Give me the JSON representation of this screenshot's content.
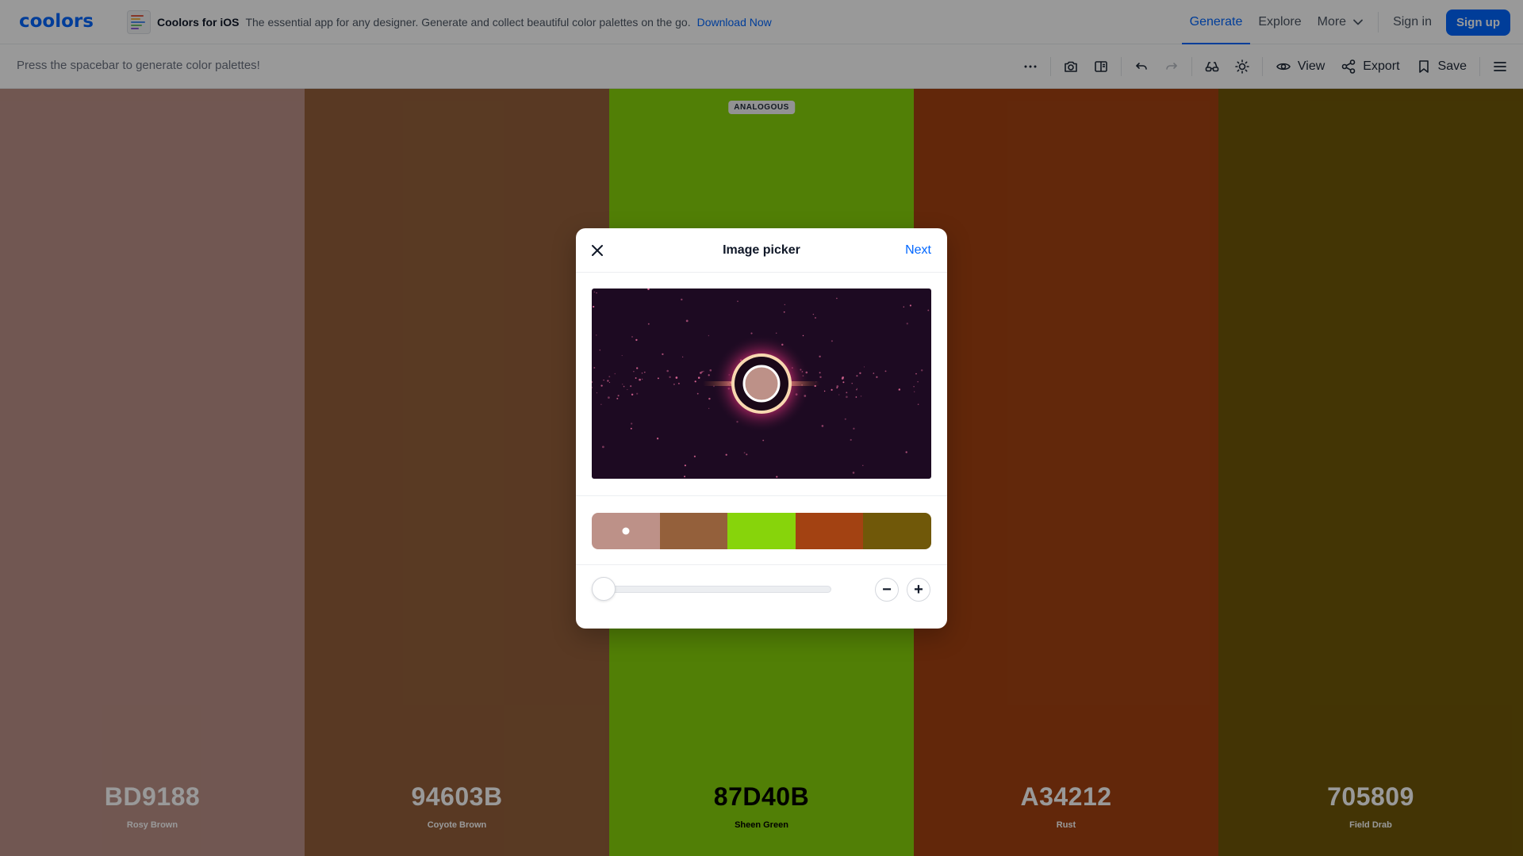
{
  "header": {
    "logo": "coolors",
    "promo": {
      "title": "Coolors for iOS",
      "text": "The essential app for any designer. Generate and collect beautiful color palettes on the go.",
      "link": "Download Now"
    },
    "nav": [
      {
        "label": "Generate",
        "active": true
      },
      {
        "label": "Explore",
        "active": false
      }
    ],
    "more": "More",
    "signin": "Sign in",
    "signup": "Sign up"
  },
  "toolbar": {
    "hint": "Press the spacebar to generate color palettes!",
    "icons": [
      "more-icon",
      "camera-icon",
      "columns-icon",
      "undo-icon",
      "redo-icon",
      "glasses-icon",
      "sun-icon"
    ],
    "view": "View",
    "export": "Export",
    "save": "Save"
  },
  "palette": {
    "badge": "ANALOGOUS",
    "colors": [
      {
        "hex": "BD9188",
        "name": "Rosy Brown",
        "bg": "#BD9188",
        "fg": "#ffffff"
      },
      {
        "hex": "94603B",
        "name": "Coyote Brown",
        "bg": "#94603B",
        "fg": "#ffffff"
      },
      {
        "hex": "87D40B",
        "name": "Sheen Green",
        "bg": "#87D40B",
        "fg": "#000000"
      },
      {
        "hex": "A34212",
        "name": "Rust",
        "bg": "#A34212",
        "fg": "#ffffff"
      },
      {
        "hex": "705809",
        "name": "Field Drab",
        "bg": "#705809",
        "fg": "#ffffff"
      }
    ]
  },
  "modal": {
    "title": "Image picker",
    "next": "Next",
    "swatches": [
      "#BD9188",
      "#94603B",
      "#87D40B",
      "#A34212",
      "#705809"
    ],
    "selected_swatch": 0,
    "slider_value": 0,
    "minus_label": "−",
    "plus_label": "+"
  },
  "colors": {
    "accent": "#0066ff",
    "overlay": "rgba(0,0,0,0.4)"
  }
}
